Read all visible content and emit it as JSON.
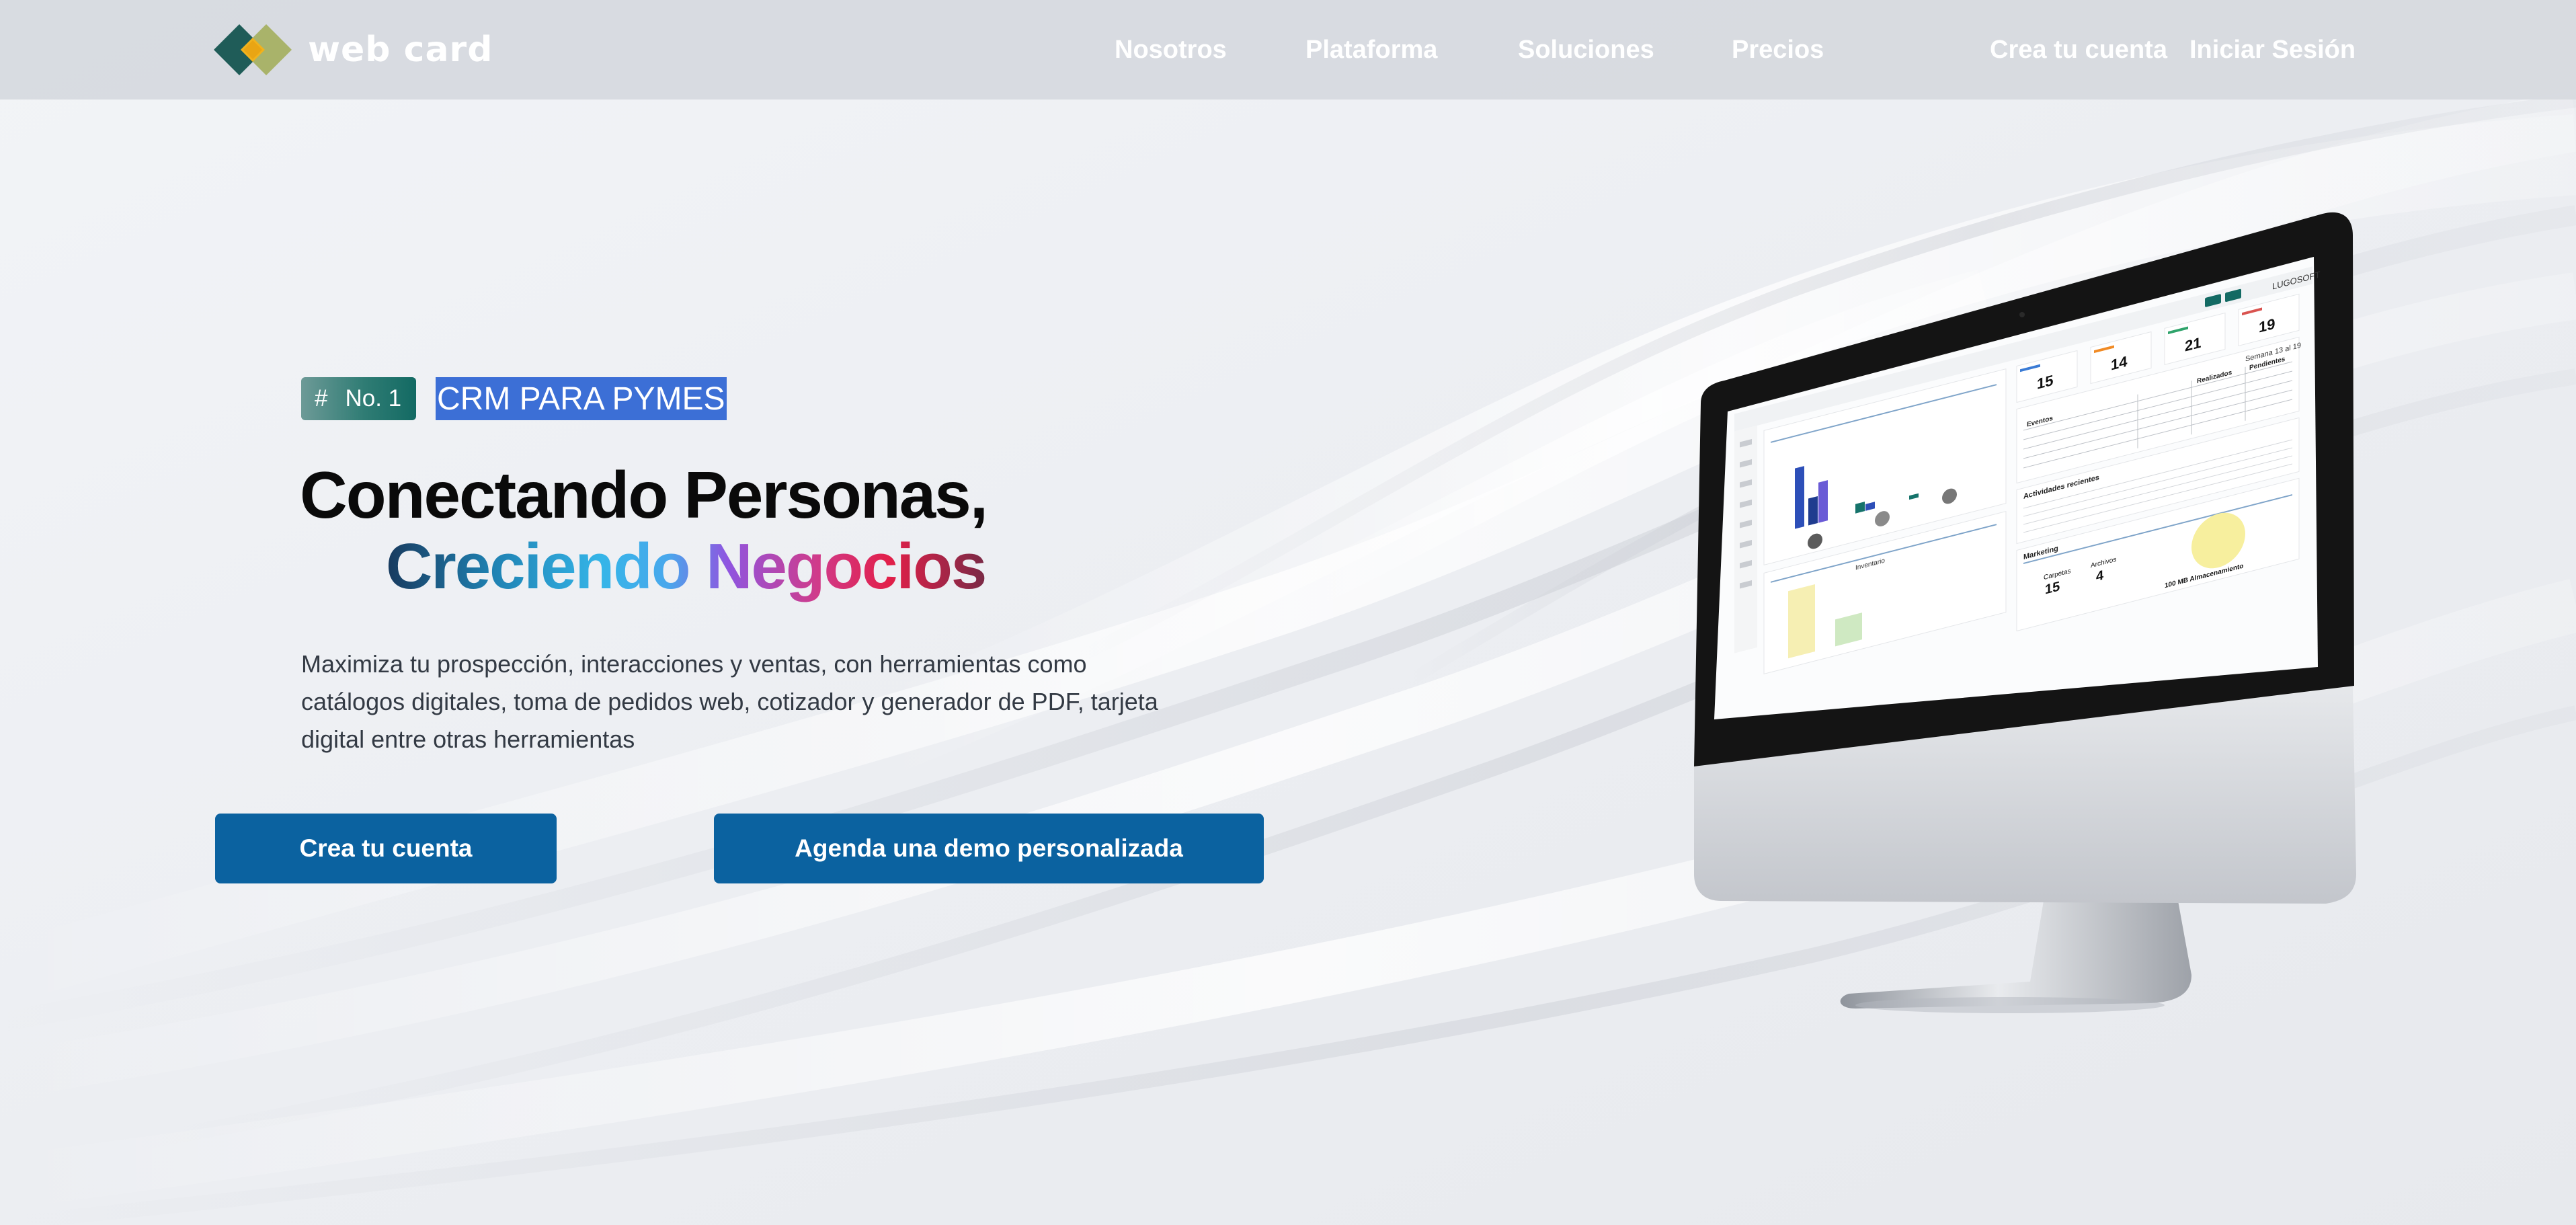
{
  "brand": {
    "name": "web card",
    "colors": {
      "logo_dark": "#1f5c58",
      "logo_light": "#a9b36a",
      "logo_center": "#f2b21c",
      "button": "#0b62a0",
      "badge": "#136a63",
      "highlight": "#3c6fd6"
    }
  },
  "nav": {
    "links": [
      {
        "label": "Nosotros"
      },
      {
        "label": "Plataforma"
      },
      {
        "label": "Soluciones"
      },
      {
        "label": "Precios"
      }
    ],
    "signup": "Crea tu cuenta",
    "login": "Iniciar Sesión"
  },
  "hero": {
    "badge_hash": "#",
    "badge_rank": "No. 1",
    "badge_text": "CRM PARA PYMES",
    "headline_line1": "Conectando Personas,",
    "headline_line2": "Creciendo Negocios",
    "description": "Maximiza tu prospección, interacciones y ventas, con herramientas como catálogos digitales, toma de pedidos web, cotizador y generador de PDF, tarjeta digital entre otras herramientas",
    "cta_primary": "Crea tu cuenta",
    "cta_secondary": "Agenda una demo personalizada"
  },
  "monitor_screen": {
    "top_label": "LUGOSOFT",
    "kpis": [
      "15",
      "14",
      "21",
      "19"
    ],
    "week_label": "Semana 13 al 19",
    "table_headers": [
      "Eventos",
      "Realizados",
      "Pendientes"
    ],
    "activities_title": "Actividades recientes",
    "marketing_title": "Marketing",
    "carpetas_label": "Carpetas",
    "carpetas_value": "15",
    "archivos_label": "Archivos",
    "archivos_value": "4",
    "storage_label": "100 MB Almacenamiento",
    "inventory_label": "Inventario"
  }
}
